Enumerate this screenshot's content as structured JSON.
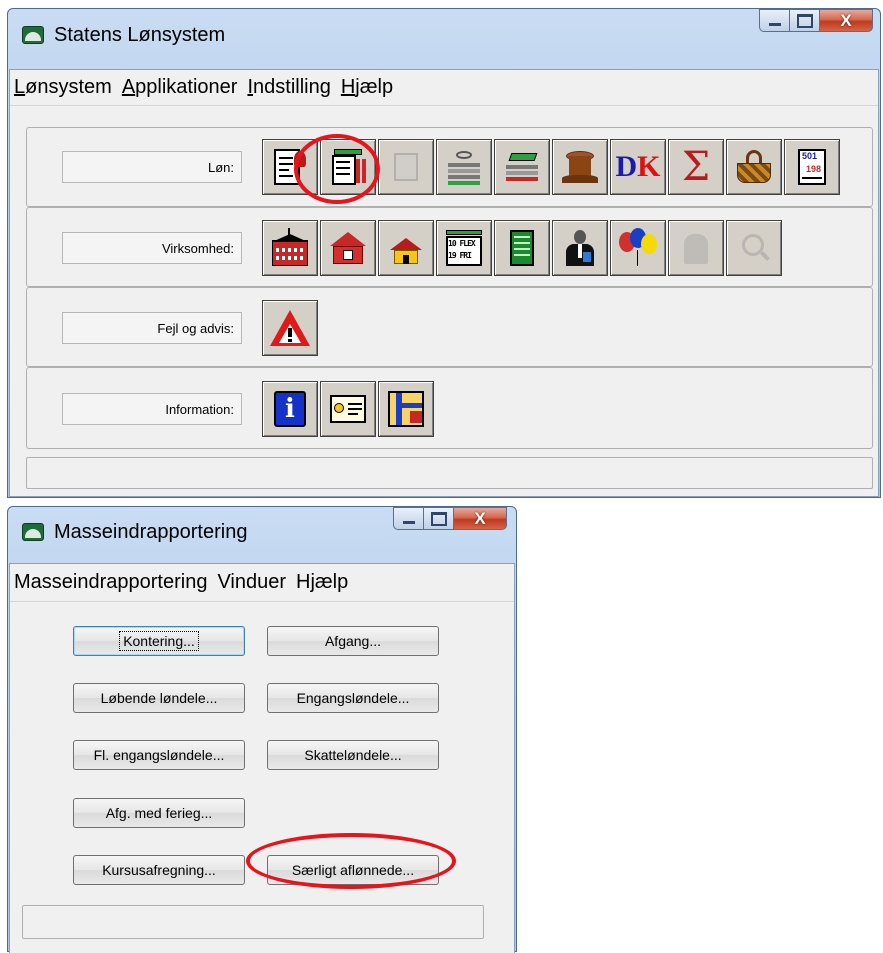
{
  "main_window": {
    "title": "Statens Lønsystem",
    "caption": {
      "close": "X"
    },
    "menu": [
      {
        "label": "Lønsystem"
      },
      {
        "label": "Applikationer"
      },
      {
        "label": "Indstilling"
      },
      {
        "label": "Hjælp"
      }
    ],
    "rows": [
      {
        "label": "Løn:",
        "icons": [
          "loen-document-icon",
          "loen-list-icon",
          "loen-disabled-icon",
          "stack-icon",
          "green-stack-icon",
          "tree-stump-icon",
          "dk-icon",
          "sigma-icon",
          "basket-icon",
          "calendar-501-icon"
        ]
      },
      {
        "label": "Virksomhed:",
        "icons": [
          "building-red-large-icon",
          "building-red-icon",
          "house-yellow-icon",
          "flex-fri-icon",
          "green-sheet-icon",
          "person-suit-icon",
          "balloons-icon",
          "disabled-person-icon",
          "disabled-search-icon"
        ]
      },
      {
        "label": "Fejl og advis:",
        "icons": [
          "warning-icon"
        ]
      },
      {
        "label": "Information:",
        "icons": [
          "info-icon",
          "document-window-icon",
          "map-icon"
        ]
      }
    ],
    "icon_texts": {
      "flex_top": "10 FLEX",
      "flex_bottom": "19 FRI",
      "dk": "DK",
      "cal_top": "501",
      "cal_bottom": "198"
    }
  },
  "second_window": {
    "title": "Masseindrapportering",
    "caption": {
      "close": "X"
    },
    "menu": [
      {
        "label": "Masseindrapportering"
      },
      {
        "label": "Vinduer"
      },
      {
        "label": "Hjælp"
      }
    ],
    "buttons": {
      "kontering": "Kontering...",
      "afgang": "Afgang...",
      "loebende": "Løbende løndele...",
      "engangs": "Engangsløndele...",
      "fl_engangs": "Fl. engangsløndele...",
      "skatte": "Skatteløndele...",
      "afg_ferieg": "Afg. med ferieg...",
      "kursus": "Kursusafregning...",
      "saerligt": "Særligt aflønnede..."
    }
  },
  "colors": {
    "highlight_ring": "#e8131b"
  }
}
